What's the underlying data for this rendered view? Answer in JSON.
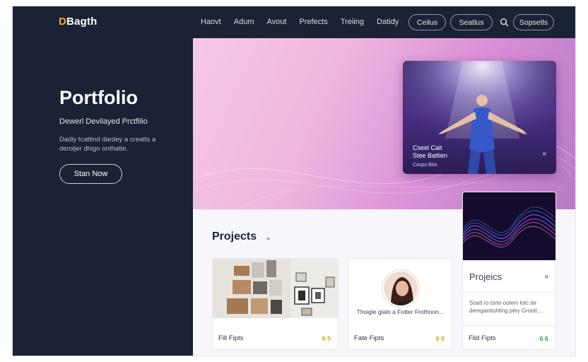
{
  "header": {
    "logo_mark": "D",
    "logo_text": "Bagth",
    "nav": [
      "Haovt",
      "Adum",
      "Avout",
      "Prefects",
      "Treiing",
      "Datidy"
    ],
    "pill_1": "Ceilus",
    "pill_2": "Seatlus",
    "pill_3": "Sopsetls"
  },
  "hero": {
    "title": "Portfolio",
    "subtitle": "Dewerl Devilayed Prctfilio",
    "description": "Dadiy tcattind dardey a creatts a deroljer dhign onthatte.",
    "cta": "Stan Now"
  },
  "feature": {
    "caption_line1": "Cseel Cait",
    "caption_line2": "Stee Battien",
    "caption_small": "Caspo Bita",
    "arrow": "»"
  },
  "projects": {
    "title": "Projects",
    "chevron": "⌄",
    "cards": [
      {
        "footer": "Fill Fipts",
        "badge": "6 5",
        "badge_color": "#e8a12a"
      },
      {
        "text": "Thoigle gialo a Fotter Frothnon…",
        "footer": "Fate Fipts",
        "badge": "6 6",
        "badge_color": "#e8a12a"
      },
      {
        "title": "Projeics",
        "arrow": "»",
        "desc": "Soatt to tsrte oolem lotc ter demgantiuhting pley Grooit…",
        "footer": "Fild Fipts",
        "badge": "6 6",
        "badge_color": "#3aa35b"
      }
    ]
  },
  "colors": {
    "dark": "#1b2236",
    "accent": "#f2a623",
    "hero_pink": "#efb5df"
  }
}
